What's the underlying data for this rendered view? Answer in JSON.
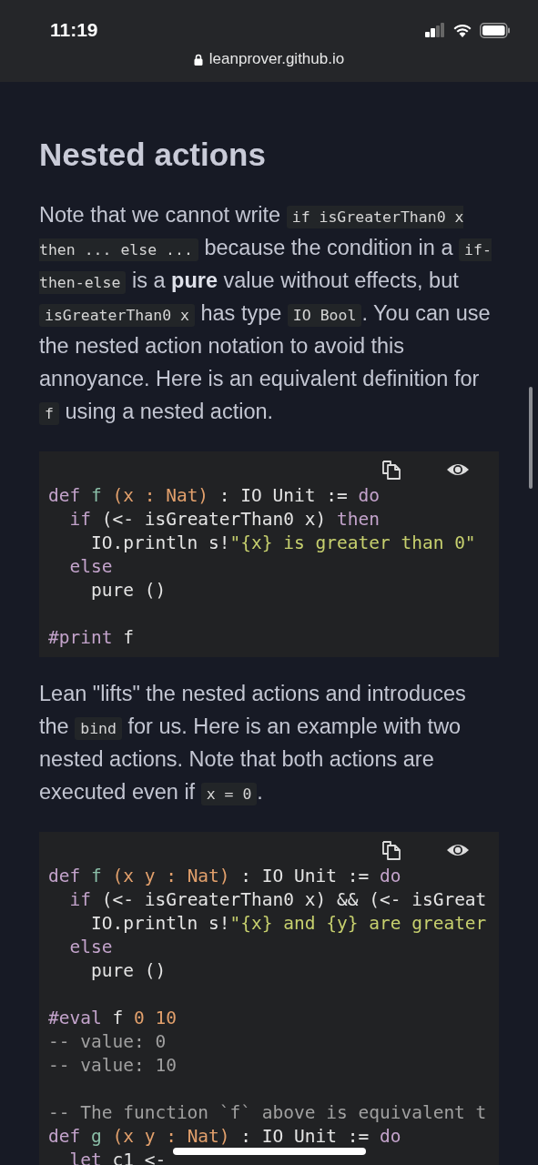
{
  "status_bar": {
    "time": "11:19"
  },
  "address_bar": {
    "url": "leanprover.github.io"
  },
  "content": [
    {
      "kind": "heading",
      "text": "Nested actions"
    },
    {
      "kind": "paragraph",
      "segments": [
        {
          "kind": "text",
          "text": "Note that we cannot write "
        },
        {
          "kind": "code",
          "text": "if isGreaterThan0 x then ... else ..."
        },
        {
          "kind": "text",
          "text": " because the condition in a "
        },
        {
          "kind": "code",
          "text": "if-then-else"
        },
        {
          "kind": "text",
          "text": " is a **pure** value without effects, but "
        },
        {
          "kind": "code",
          "text": "isGreaterThan0 x"
        },
        {
          "kind": "text",
          "text": " has type "
        },
        {
          "kind": "code",
          "text": "IO Bool"
        },
        {
          "kind": "text",
          "text": ". You can use the nested action notation to avoid this annoyance. Here is an equivalent definition for "
        },
        {
          "kind": "code",
          "text": "f"
        },
        {
          "kind": "text",
          "text": " using a nested action."
        }
      ]
    },
    {
      "kind": "code_block",
      "lines": [
        {
          "kind": "code",
          "tokens": [
            {
              "kind": "keyword",
              "text": "def "
            },
            {
              "kind": "name",
              "text": "f "
            },
            {
              "kind": "binder",
              "text": "(x : Nat)"
            },
            {
              "kind": "plain",
              "text": " : IO Unit := "
            },
            {
              "kind": "keyword",
              "text": "do"
            }
          ]
        },
        {
          "kind": "code",
          "tokens": [
            {
              "kind": "keyword",
              "text": "  if"
            },
            {
              "kind": "plain",
              "text": " (<- isGreaterThan0 x) "
            },
            {
              "kind": "keyword",
              "text": "then"
            }
          ]
        },
        {
          "kind": "code",
          "tokens": [
            {
              "kind": "plain",
              "text": "    IO.println s!"
            },
            {
              "kind": "string",
              "text": "\"{x} is greater than 0\""
            }
          ]
        },
        {
          "kind": "code",
          "tokens": [
            {
              "kind": "keyword",
              "text": "  else"
            }
          ]
        },
        {
          "kind": "code",
          "tokens": [
            {
              "kind": "plain",
              "text": "    pure ()"
            }
          ]
        },
        {
          "kind": "blank"
        },
        {
          "kind": "code",
          "tokens": [
            {
              "kind": "keyword",
              "text": "#print"
            },
            {
              "kind": "plain",
              "text": " f"
            }
          ]
        }
      ]
    },
    {
      "kind": "paragraph",
      "segments": [
        {
          "kind": "text",
          "text": "Lean \"lifts\" the nested actions and introduces the "
        },
        {
          "kind": "code",
          "text": "bind"
        },
        {
          "kind": "text",
          "text": " for us. Here is an example with two nested actions. Note that both actions are executed even if "
        },
        {
          "kind": "code",
          "text": "x = 0"
        },
        {
          "kind": "text",
          "text": "."
        }
      ]
    },
    {
      "kind": "code_block",
      "lines": [
        {
          "kind": "code",
          "tokens": [
            {
              "kind": "keyword",
              "text": "def "
            },
            {
              "kind": "name",
              "text": "f "
            },
            {
              "kind": "binder",
              "text": "(x y : Nat)"
            },
            {
              "kind": "plain",
              "text": " : IO Unit := "
            },
            {
              "kind": "keyword",
              "text": "do"
            }
          ]
        },
        {
          "kind": "code",
          "tokens": [
            {
              "kind": "keyword",
              "text": "  if"
            },
            {
              "kind": "plain",
              "text": " (<- isGreaterThan0 x) && (<- isGreat"
            }
          ]
        },
        {
          "kind": "code",
          "tokens": [
            {
              "kind": "plain",
              "text": "    IO.println s!"
            },
            {
              "kind": "string",
              "text": "\"{x} and {y} are greater"
            }
          ]
        },
        {
          "kind": "code",
          "tokens": [
            {
              "kind": "keyword",
              "text": "  else"
            }
          ]
        },
        {
          "kind": "code",
          "tokens": [
            {
              "kind": "plain",
              "text": "    pure ()"
            }
          ]
        },
        {
          "kind": "blank"
        },
        {
          "kind": "code",
          "tokens": [
            {
              "kind": "keyword",
              "text": "#eval"
            },
            {
              "kind": "plain",
              "text": " f "
            },
            {
              "kind": "number",
              "text": "0 10"
            }
          ]
        },
        {
          "kind": "code",
          "tokens": [
            {
              "kind": "comment",
              "text": "-- value: 0"
            }
          ]
        },
        {
          "kind": "code",
          "tokens": [
            {
              "kind": "comment",
              "text": "-- value: 10"
            }
          ]
        },
        {
          "kind": "blank"
        },
        {
          "kind": "code",
          "tokens": [
            {
              "kind": "comment",
              "text": "-- The function `f` above is equivalent t"
            }
          ]
        },
        {
          "kind": "code",
          "tokens": [
            {
              "kind": "keyword",
              "text": "def "
            },
            {
              "kind": "name",
              "text": "g "
            },
            {
              "kind": "binder",
              "text": "(x y : Nat)"
            },
            {
              "kind": "plain",
              "text": " : IO Unit := "
            },
            {
              "kind": "keyword",
              "text": "do"
            }
          ]
        },
        {
          "kind": "code",
          "tokens": [
            {
              "kind": "keyword",
              "text": "  let"
            },
            {
              "kind": "plain",
              "text": " c1 <-"
            }
          ]
        }
      ]
    }
  ]
}
